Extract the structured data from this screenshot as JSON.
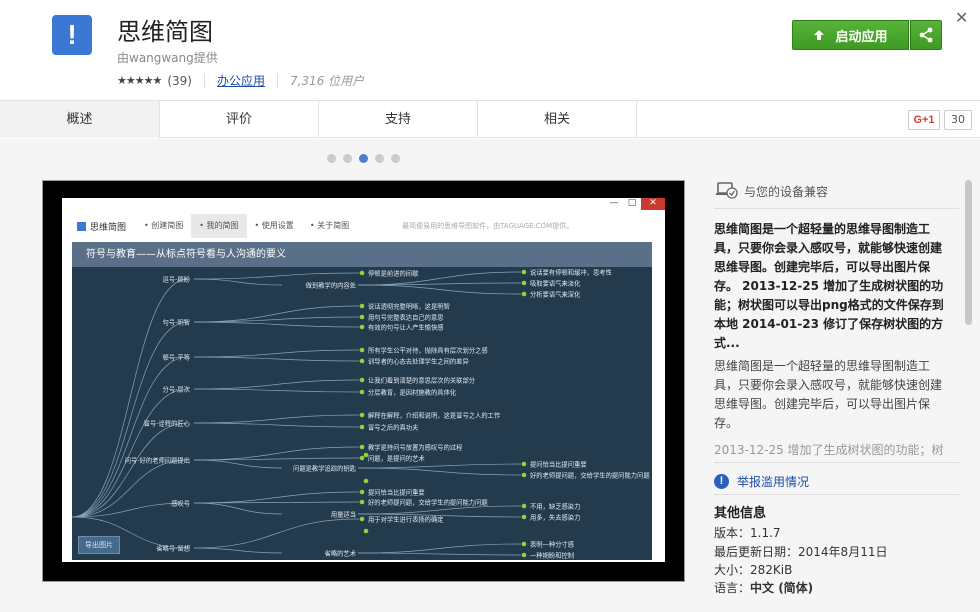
{
  "header": {
    "icon_glyph": "!",
    "title": "思维简图",
    "author": "由wangwang提供",
    "stars": "★★★★★",
    "rating_count": "(39)",
    "category": "办公应用",
    "users": "7,316 位用户",
    "launch_label": "启动应用",
    "close_glyph": "✕"
  },
  "tabs": [
    {
      "label": "概述",
      "active": true
    },
    {
      "label": "评价",
      "active": false
    },
    {
      "label": "支持",
      "active": false
    },
    {
      "label": "相关",
      "active": false
    }
  ],
  "social": {
    "gplus_label": "G+1",
    "gplus_count": "30"
  },
  "carousel": {
    "count": 5,
    "active_index": 2
  },
  "screenshot": {
    "window_controls": [
      "—",
      "□",
      "✕"
    ],
    "app_name": "思维简图",
    "nav": [
      "• 创建简图",
      "• 我的简图",
      "• 使用设置",
      "• 关于简图"
    ],
    "nav_active_index": 1,
    "hint": "最简便易用的思维导图软件，由TAGUAGE.COM提供。",
    "map_title": "符号与教育——从标点符号看与人沟通的要义",
    "export_button": "导出图片",
    "left_nodes": [
      "逗号-顾盼",
      "句号-明智",
      "顿号-平等",
      "分号-层次",
      "冒号-诠释的匠心",
      "问号-好的老师问题提出",
      "感叹号",
      "省略号-留想"
    ],
    "mid_nodes": [
      "做到教学的内容处",
      "问题是教学追踪的钥匙",
      "用量适当",
      "省略的艺术"
    ],
    "right_nodes": [
      "说话要有停顿和缓冲，思考性",
      "吸取要语气来淡化",
      "分析要语气来深化",
      "不用，缺乏感染力",
      "用多，失去感染力",
      "表明一种分寸感",
      "一种期盼和控制"
    ],
    "leaf_nodes": [
      "停顿是前进的间歇",
      "说话透彻完整明晰，这是明智",
      "用句号完整表达自己的意思",
      "有效的句号让人产生愉快感",
      "所有学生公平对待，抛除具有层次划分之感",
      "训导者的心态去处理学生之间的差异",
      "让我们看到清楚的意思层次的关联部分",
      "分层教育，是因材施教的具体化",
      "解释在解释，介绍和说明，这是冒号之人的工作",
      "冒号之后的真功夫",
      "教学是持问号放置为感叹号的过程",
      "问题，是提问的艺术",
      "提问恰当比提问重要",
      "好的老师提问题，交给学生的提问能力问题",
      "用于对学生进行表扬的确定",
      "用于对学生鼓励或者事理的表明",
      "适当留下思考的空间"
    ]
  },
  "sidebar": {
    "compat_label": "与您的设备兼容",
    "desc_bold": "思维简图是一个超轻量的思维导图制造工具，只要你会录入感叹号，就能够快速创建思维导图。创建完毕后，可以导出图片保存。 2013-12-25 增加了生成树状图的功能；树状图可以导出png格式的文件保存到本地 2014-01-23 修订了保存树状图的方式...",
    "desc_normal": "思维简图是一个超轻量的思维导图制造工具，只要你会录入感叹号，就能够快速创建思维导图。创建完毕后，可以导出图片保存。",
    "desc_fade": "2013-12-25 增加了生成树状图的功能；树",
    "report_label": "举报滥用情况",
    "info_title": "其他信息",
    "info": [
      {
        "label": "版本：",
        "value": "1.1.7"
      },
      {
        "label": "最后更新日期：",
        "value": "2014年8月11日"
      },
      {
        "label": "大小：",
        "value": "282KiB"
      },
      {
        "label": "语言：",
        "value": "中文 (简体)"
      }
    ]
  },
  "colors": {
    "accent_green": "#4aa62c",
    "link_blue": "#1e4ba3",
    "mindmap_bg": "#243b4e",
    "node_dot": "#8fd43a"
  }
}
